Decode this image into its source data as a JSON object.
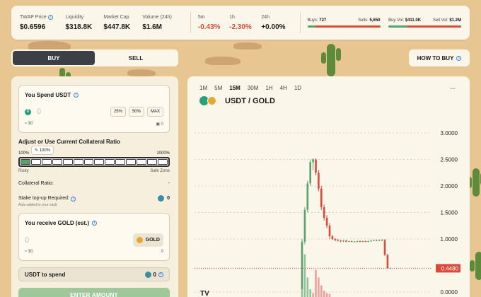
{
  "stats": [
    {
      "label": "TWAP Price",
      "value": "$0.6596",
      "info": true,
      "negative": false
    },
    {
      "label": "Liquidity",
      "value": "$318.8K",
      "info": false,
      "negative": false
    },
    {
      "label": "Market Cap",
      "value": "$447.8K",
      "info": false,
      "negative": false
    },
    {
      "label": "Volume (24h)",
      "value": "$1.6M",
      "info": false,
      "negative": false
    }
  ],
  "changes": [
    {
      "label": "5m",
      "value": "-0.43%",
      "negative": true
    },
    {
      "label": "1h",
      "value": "-2.30%",
      "negative": true
    },
    {
      "label": "24h",
      "value": "+0.00%",
      "negative": false
    }
  ],
  "buys_sells": {
    "buys_label": "Buys:",
    "buys": "727",
    "sells_label": "Sells:",
    "sells": "5,650",
    "buy_share": 0.11
  },
  "vols": {
    "buy_label": "Buy Vol:",
    "buy": "$411.0K",
    "sell_label": "Sell Vol:",
    "sell": "$1.2M",
    "buy_share": 0.26
  },
  "colors": {
    "green": "#5aa06a",
    "red": "#d9493c",
    "dark": "#3c3f44"
  },
  "toggle": {
    "buy": "BUY",
    "sell": "SELL"
  },
  "how_to_buy": "HOW TO BUY",
  "spend": {
    "title": "You Spend USDT",
    "amount_placeholder": "0",
    "pct25": "25%",
    "pct50": "50%",
    "max": "MAX",
    "usd": "≈ $0",
    "balance": "0"
  },
  "collateral": {
    "title": "Adjust or Use Current Collateral Ratio",
    "current": "100%",
    "min": "100%",
    "max": "1000%",
    "risky": "Risky",
    "safe": "Safe Zone",
    "level_fraction": 0.0
  },
  "collateral_ratio": {
    "label": "Collateral Ratio:",
    "value": "-"
  },
  "stake": {
    "label": "Stake top-up Required:",
    "value": "0",
    "sub": "Auto-added to your vault"
  },
  "receive": {
    "title": "You receive GOLD (est.)",
    "amount_placeholder": "0",
    "token": "GOLD",
    "usd": "≈ $0",
    "balance": "0"
  },
  "to_spend": {
    "label": "USDT to spend",
    "value": "0"
  },
  "enter_amount": "ENTER AMOUNT",
  "chart_timeframes": [
    "1M",
    "5M",
    "15M",
    "30M",
    "1H",
    "4H",
    "1D"
  ],
  "chart_selected": "15M",
  "pair": "USDT / GOLD",
  "chart_data": {
    "type": "candlestick",
    "y_ticks": [
      "3.0000",
      "2.5000",
      "2.0000",
      "1.5000",
      "1.0000",
      "0.0000"
    ],
    "ylim": [
      0,
      3.0
    ],
    "last_price": "0.4480",
    "candles": [
      {
        "o": 0.05,
        "c": 0.95,
        "h": 1.0,
        "l": 0.05
      },
      {
        "o": 0.95,
        "c": 1.55,
        "h": 1.6,
        "l": 0.9
      },
      {
        "o": 1.55,
        "c": 2.05,
        "h": 2.1,
        "l": 1.5
      },
      {
        "o": 2.05,
        "c": 2.45,
        "h": 2.5,
        "l": 2.0
      },
      {
        "o": 2.45,
        "c": 2.5,
        "h": 2.52,
        "l": 2.3
      },
      {
        "o": 2.5,
        "c": 2.25,
        "h": 2.52,
        "l": 2.2
      },
      {
        "o": 2.25,
        "c": 1.95,
        "h": 2.3,
        "l": 1.9
      },
      {
        "o": 1.95,
        "c": 1.6,
        "h": 2.0,
        "l": 1.55
      },
      {
        "o": 1.6,
        "c": 1.4,
        "h": 1.65,
        "l": 1.35
      },
      {
        "o": 1.4,
        "c": 1.25,
        "h": 1.45,
        "l": 1.2
      },
      {
        "o": 1.25,
        "c": 1.05,
        "h": 1.3,
        "l": 1.0
      },
      {
        "o": 1.05,
        "c": 1.0,
        "h": 1.08,
        "l": 0.98
      },
      {
        "o": 1.0,
        "c": 0.98,
        "h": 1.02,
        "l": 0.96
      },
      {
        "o": 0.98,
        "c": 0.97,
        "h": 1.0,
        "l": 0.95
      },
      {
        "o": 0.97,
        "c": 0.96,
        "h": 0.98,
        "l": 0.94
      },
      {
        "o": 0.96,
        "c": 0.97,
        "h": 0.98,
        "l": 0.94
      },
      {
        "o": 0.97,
        "c": 0.95,
        "h": 0.98,
        "l": 0.94
      },
      {
        "o": 0.95,
        "c": 0.96,
        "h": 0.97,
        "l": 0.94
      },
      {
        "o": 0.96,
        "c": 0.95,
        "h": 0.97,
        "l": 0.94
      },
      {
        "o": 0.95,
        "c": 0.95,
        "h": 0.96,
        "l": 0.94
      },
      {
        "o": 0.95,
        "c": 0.96,
        "h": 0.97,
        "l": 0.94
      },
      {
        "o": 0.96,
        "c": 0.95,
        "h": 0.97,
        "l": 0.94
      },
      {
        "o": 0.95,
        "c": 0.96,
        "h": 0.97,
        "l": 0.94
      },
      {
        "o": 0.96,
        "c": 0.95,
        "h": 0.97,
        "l": 0.94
      },
      {
        "o": 0.95,
        "c": 0.96,
        "h": 0.97,
        "l": 0.94
      },
      {
        "o": 0.96,
        "c": 0.97,
        "h": 0.98,
        "l": 0.95
      },
      {
        "o": 0.97,
        "c": 0.98,
        "h": 0.99,
        "l": 0.96
      },
      {
        "o": 0.98,
        "c": 0.97,
        "h": 0.99,
        "l": 0.96
      },
      {
        "o": 0.97,
        "c": 0.98,
        "h": 0.99,
        "l": 0.96
      },
      {
        "o": 0.98,
        "c": 0.98,
        "h": 1.0,
        "l": 0.96
      },
      {
        "o": 0.98,
        "c": 0.7,
        "h": 1.0,
        "l": 0.68
      },
      {
        "o": 0.7,
        "c": 0.45,
        "h": 0.72,
        "l": 0.44
      },
      {
        "o": 0.45,
        "c": 0.45,
        "h": 0.46,
        "l": 0.44
      }
    ],
    "volumes": [
      0.1,
      0.55,
      0.25,
      0.1,
      0.05,
      0.35,
      0.25,
      0.15,
      0.08,
      0.05,
      0.04
    ]
  }
}
